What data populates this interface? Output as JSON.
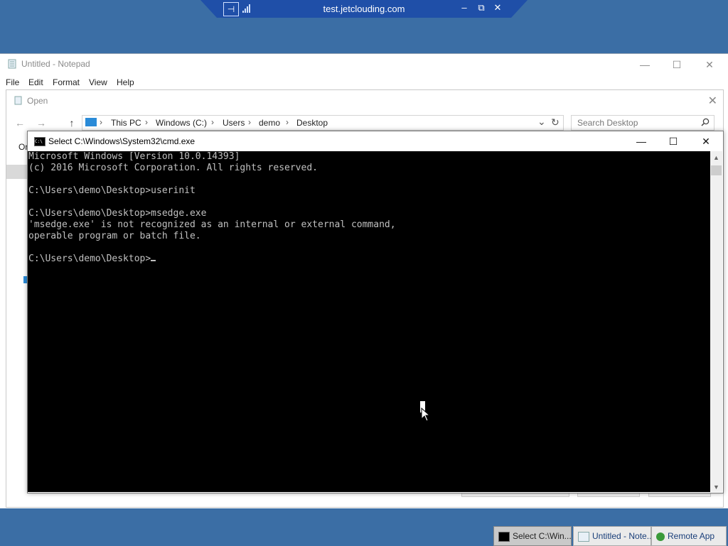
{
  "rdp_bar": {
    "host": "test.jetclouding.com",
    "pin_icon": "pin-icon",
    "signal_icon": "signal-bars-icon",
    "minimize": "‒",
    "restore": "⧉",
    "close": "✕"
  },
  "notepad": {
    "title": "Untitled - Notepad",
    "menu": [
      "File",
      "Edit",
      "Format",
      "View",
      "Help"
    ],
    "minimize": "—",
    "maximize": "☐",
    "close": "✕"
  },
  "open_dialog": {
    "title": "Open",
    "close": "✕",
    "back": "←",
    "forward": "→",
    "up": "↑",
    "breadcrumbs": [
      "This PC",
      "Windows (C:)",
      "Users",
      "demo",
      "Desktop"
    ],
    "breadcrumb_sep": "›",
    "dropdown": "⌄",
    "refresh": "↻",
    "search_placeholder": "Search Desktop",
    "fragment_text": "Or"
  },
  "cmd": {
    "title": "Select C:\\Windows\\System32\\cmd.exe",
    "minimize": "—",
    "maximize": "☐",
    "close": "✕",
    "lines": [
      "Microsoft Windows [Version 10.0.14393]",
      "(c) 2016 Microsoft Corporation. All rights reserved.",
      "",
      "C:\\Users\\demo\\Desktop>userinit",
      "",
      "C:\\Users\\demo\\Desktop>msedge.exe",
      "'msedge.exe' is not recognized as an internal or external command,",
      "operable program or batch file.",
      ""
    ],
    "prompt": "C:\\Users\\demo\\Desktop>"
  },
  "taskbar": {
    "items": [
      {
        "label": "Select C:\\Win...",
        "icon": "cmd-icon",
        "active": true
      },
      {
        "label": "Untitled - Note...",
        "icon": "notepad-icon",
        "active": false
      },
      {
        "label": "Remote App",
        "icon": "remote-app-icon",
        "active": false
      }
    ]
  },
  "colors": {
    "desktop": "#3b6ea5",
    "rdp_bar": "#1f4fa8",
    "console_bg": "#000000",
    "console_fg": "#c0c0c0"
  }
}
